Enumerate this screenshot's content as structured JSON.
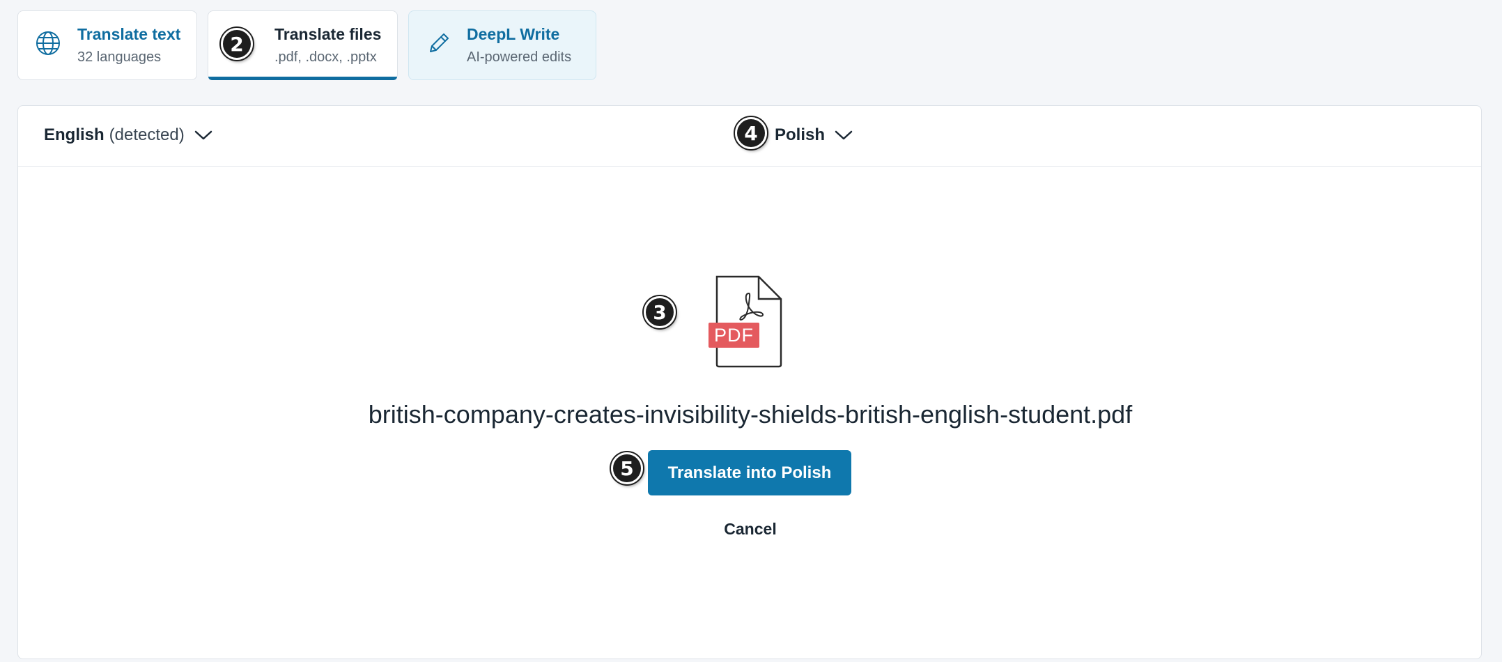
{
  "tabs": [
    {
      "title": "Translate text",
      "subtitle": "32 languages",
      "icon": "globe-icon"
    },
    {
      "title": "Translate files",
      "subtitle": ".pdf, .docx, .pptx",
      "marker": "2",
      "active": true
    },
    {
      "title": "DeepL Write",
      "subtitle": "AI-powered edits",
      "icon": "pencil-icon"
    }
  ],
  "language_bar": {
    "source_language": "English",
    "source_detected": "(detected)",
    "target_language": "Polish",
    "marker": "4"
  },
  "file": {
    "type_label": "PDF",
    "icon": "pdf-file-icon",
    "name": "british-company-creates-invisibility-shields-british-english-student.pdf",
    "marker": "3"
  },
  "actions": {
    "translate_label": "Translate into Polish",
    "translate_marker": "5",
    "cancel_label": "Cancel"
  },
  "colors": {
    "accent": "#0f6da0",
    "button": "#0f78ad",
    "pdf_badge": "#e45a5e",
    "write_tab_bg": "#eaf5fa"
  }
}
